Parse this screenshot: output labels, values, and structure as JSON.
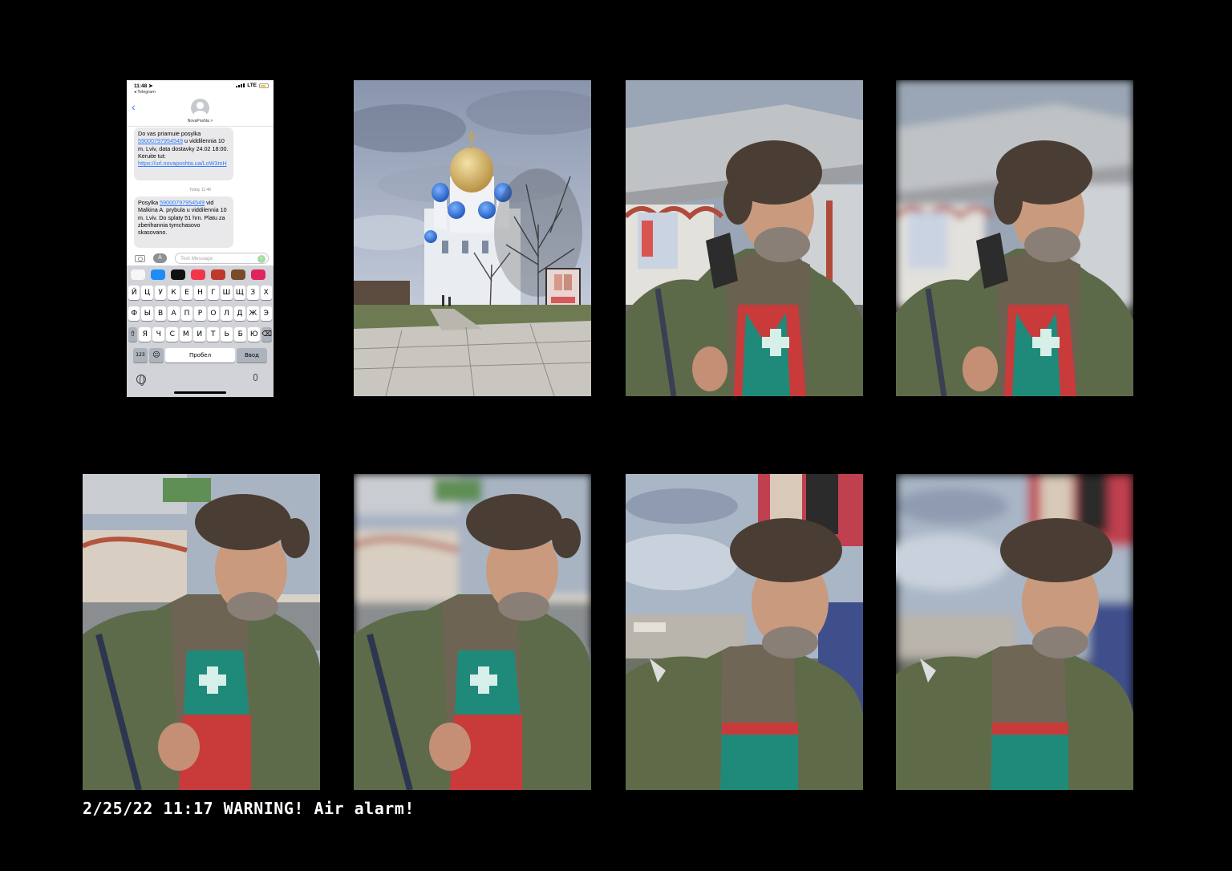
{
  "phone": {
    "status_time": "11:48",
    "status_network": "LTE",
    "back_app": "◂ Telegram",
    "contact_name": "NovaPoshta >",
    "message1": {
      "before": "Do vas priamuie posylka ",
      "tracking": "59000797954549",
      "middle": " u viddilennia 10 m. Lviv, data dostavky 24.02 18:00. Keruite tut: ",
      "link": "https://url.novaposhta.ua/LoW3mH"
    },
    "timestamp": "Today 11:48",
    "message2": {
      "before": "Posylka ",
      "tracking": "59000797954549",
      "after": " vid Malkina A. prybula u viddilennia 10 m. Lviv. Do splaty 51 hrn. Platu za zberihannia tymchasovo skasovano."
    },
    "input_placeholder": "Text Message",
    "keyboard": {
      "row1": [
        "Й",
        "Ц",
        "У",
        "К",
        "Е",
        "Н",
        "Г",
        "Ш",
        "Щ",
        "З",
        "Х"
      ],
      "row2": [
        "Ф",
        "Ы",
        "В",
        "А",
        "П",
        "Р",
        "О",
        "Л",
        "Д",
        "Ж",
        "Э"
      ],
      "row3": [
        "Я",
        "Ч",
        "С",
        "М",
        "И",
        "Т",
        "Ь",
        "Б",
        "Ю"
      ],
      "num_key": "123",
      "space_key": "Пробел",
      "return_key": "Ввод"
    }
  },
  "photos": [
    {
      "name": "cathedral-photo"
    },
    {
      "name": "man-photo-1"
    },
    {
      "name": "man-photo-1-blurred"
    },
    {
      "name": "man-photo-2"
    },
    {
      "name": "man-photo-2-blurred"
    },
    {
      "name": "man-photo-3"
    },
    {
      "name": "man-photo-3-blurred"
    }
  ],
  "caption": "2/25/22 11:17 WARNING! Air alarm!"
}
